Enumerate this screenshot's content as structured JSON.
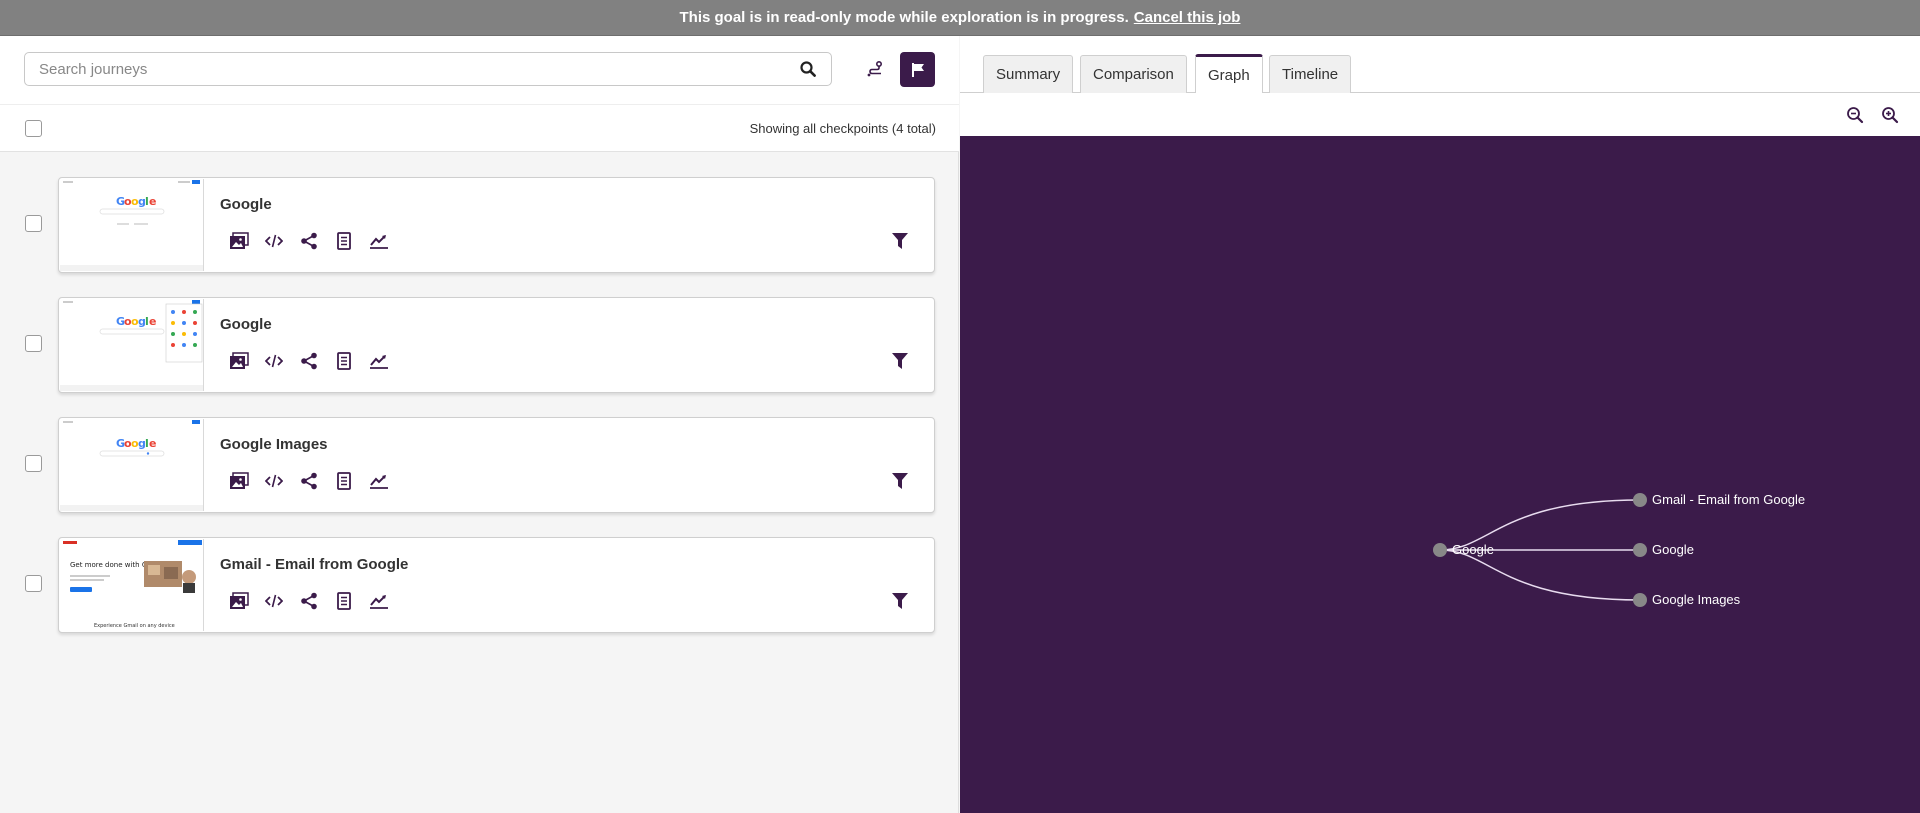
{
  "banner": {
    "message": "This goal is in read-only mode while exploration is in progress.",
    "link": "Cancel this job"
  },
  "search": {
    "placeholder": "Search journeys",
    "value": ""
  },
  "list": {
    "count_text": "Showing all checkpoints (4 total)"
  },
  "checkpoints": [
    {
      "title": "Google",
      "thumb": "google-home"
    },
    {
      "title": "Google",
      "thumb": "google-apps"
    },
    {
      "title": "Google Images",
      "thumb": "google-images"
    },
    {
      "title": "Gmail - Email from Google",
      "thumb": "gmail",
      "thumb_text": "Get more done with Gmail"
    }
  ],
  "tabs": [
    "Summary",
    "Comparison",
    "Graph",
    "Timeline"
  ],
  "active_tab": "Graph",
  "graph": {
    "root": "Google",
    "children": [
      "Gmail - Email from Google",
      "Google",
      "Google Images"
    ]
  },
  "colors": {
    "brand": "#3b1b4a",
    "banner": "#818181",
    "node": "#888888",
    "edge": "#e8dcef"
  }
}
